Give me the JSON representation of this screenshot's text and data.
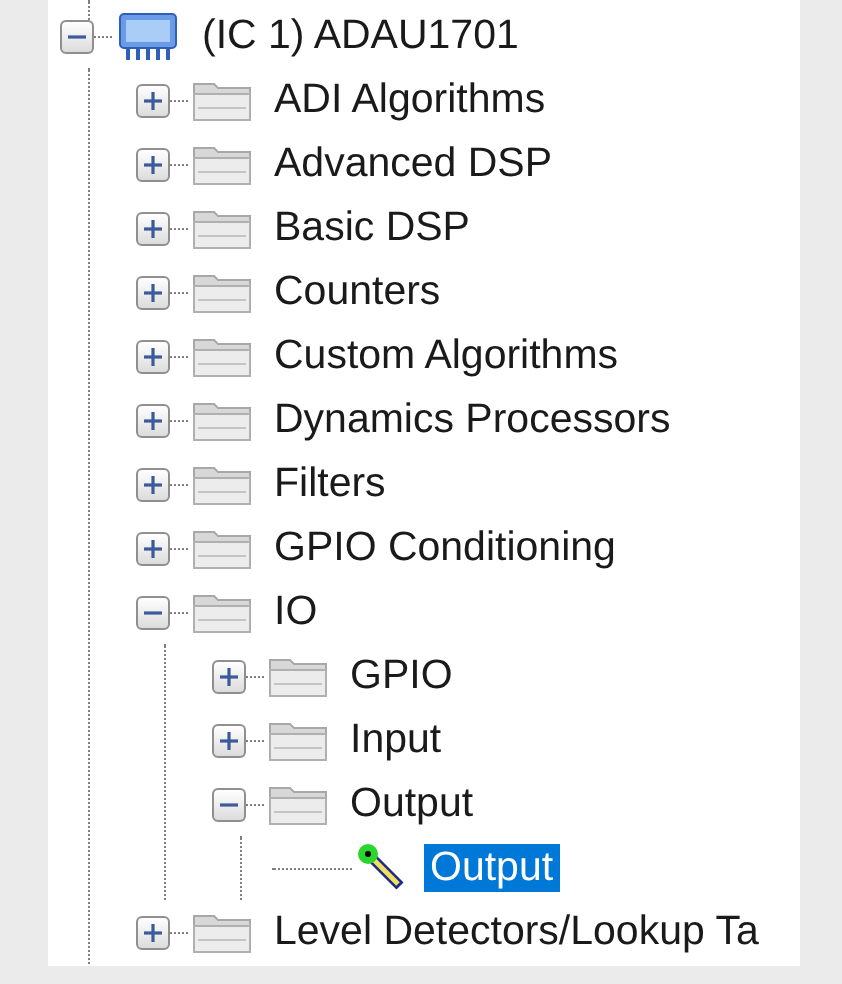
{
  "tree": [
    {
      "label": "(IC 1) ADAU1701",
      "kind": "chip",
      "expanded": true,
      "selected": false,
      "children": [
        {
          "label": "ADI Algorithms",
          "kind": "folder",
          "expanded": false,
          "selected": false
        },
        {
          "label": "Advanced DSP",
          "kind": "folder",
          "expanded": false,
          "selected": false
        },
        {
          "label": "Basic DSP",
          "kind": "folder",
          "expanded": false,
          "selected": false
        },
        {
          "label": "Counters",
          "kind": "folder",
          "expanded": false,
          "selected": false
        },
        {
          "label": "Custom Algorithms",
          "kind": "folder",
          "expanded": false,
          "selected": false
        },
        {
          "label": "Dynamics Processors",
          "kind": "folder",
          "expanded": false,
          "selected": false
        },
        {
          "label": "Filters",
          "kind": "folder",
          "expanded": false,
          "selected": false
        },
        {
          "label": "GPIO Conditioning",
          "kind": "folder",
          "expanded": false,
          "selected": false
        },
        {
          "label": "IO",
          "kind": "folder",
          "expanded": true,
          "selected": false,
          "children": [
            {
              "label": "GPIO",
              "kind": "folder",
              "expanded": false,
              "selected": false
            },
            {
              "label": "Input",
              "kind": "folder",
              "expanded": false,
              "selected": false
            },
            {
              "label": "Output",
              "kind": "folder",
              "expanded": true,
              "selected": false,
              "children": [
                {
                  "label": "Output",
                  "kind": "block",
                  "selected": true
                }
              ]
            }
          ]
        },
        {
          "label": "Level Detectors/Lookup Ta",
          "kind": "folder",
          "expanded": false,
          "selected": false
        }
      ]
    }
  ]
}
